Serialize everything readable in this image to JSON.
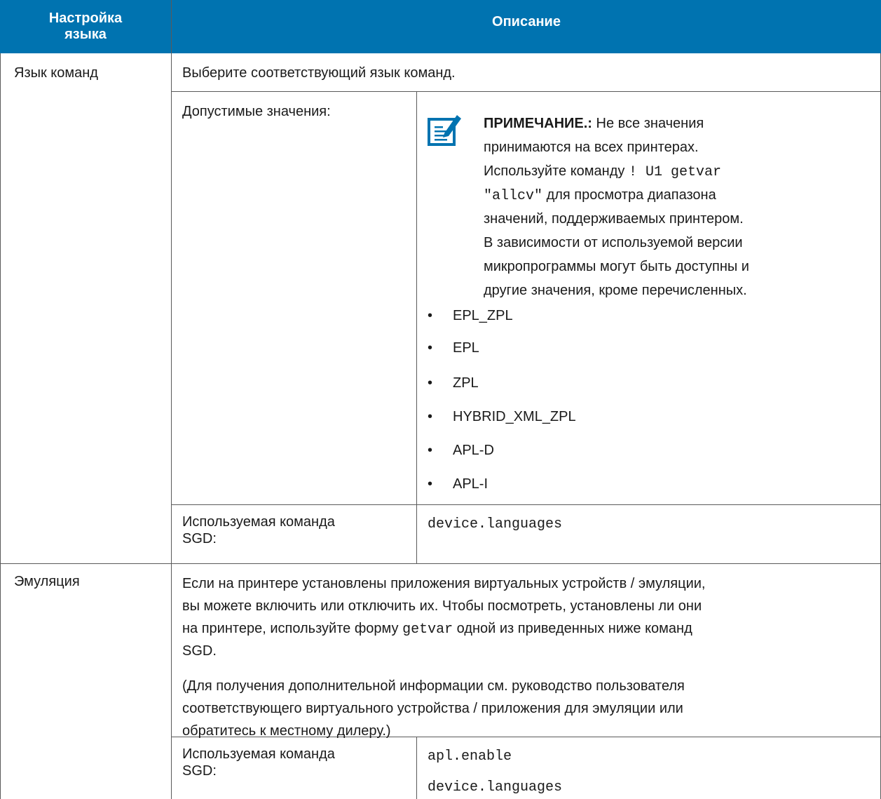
{
  "header": {
    "col1": "Настройка языка",
    "col2": "Описание"
  },
  "rows": {
    "command_language": {
      "label": "Язык команд",
      "description": "Выберите соответствующий язык команд.",
      "values_label": "Допустимые значения:",
      "note_title": "ПРИМЕЧАНИЕ.:",
      "note_l1": " Не все значения",
      "note_l2": "принимаются на всех принтерах.",
      "note_l3a": "Используйте команду ",
      "note_l3code": "! U1 getvar",
      "note_l4code": "\"allcv\"",
      "note_l4b": " для просмотра диапазона",
      "note_l5": "значений, поддерживаемых принтером.",
      "note_l6": "В зависимости от используемой версии",
      "note_l7": "микропрограммы могут быть доступны и",
      "note_l8": "другие значения, кроме перечисленных.",
      "values": [
        "EPL_ZPL",
        "EPL",
        "ZPL",
        "HYBRID_XML_ZPL",
        "APL-D",
        "APL-I"
      ],
      "sgd_label_l1": "Используемая команда",
      "sgd_label_l2": "SGD:",
      "sgd_value": "device.languages"
    },
    "emulation": {
      "label": "Эмуляция",
      "p1_l1": "Если на принтере установлены приложения виртуальных устройств / эмуляции,",
      "p1_l2": "вы можете включить или отключить их. Чтобы посмотреть, установлены ли они",
      "p1_l3a": "на принтере, используйте форму ",
      "p1_l3code": "getvar",
      "p1_l3b": " одной из приведенных ниже команд",
      "p1_l4": "SGD.",
      "p2_l1": "(Для получения дополнительной информации см. руководство пользователя",
      "p2_l2": "соответствующего виртуального устройства / приложения для эмуляции или",
      "p2_l3": "обратитесь к местному дилеру.)",
      "sgd_label_l1": "Используемая команда",
      "sgd_label_l2": "SGD:",
      "sgd_values": [
        "apl.enable",
        "device.languages"
      ]
    }
  },
  "colors": {
    "header_bg": "#0073b0",
    "note_icon": "#0073b0"
  },
  "icons": {
    "note": "note-pencil-icon"
  }
}
